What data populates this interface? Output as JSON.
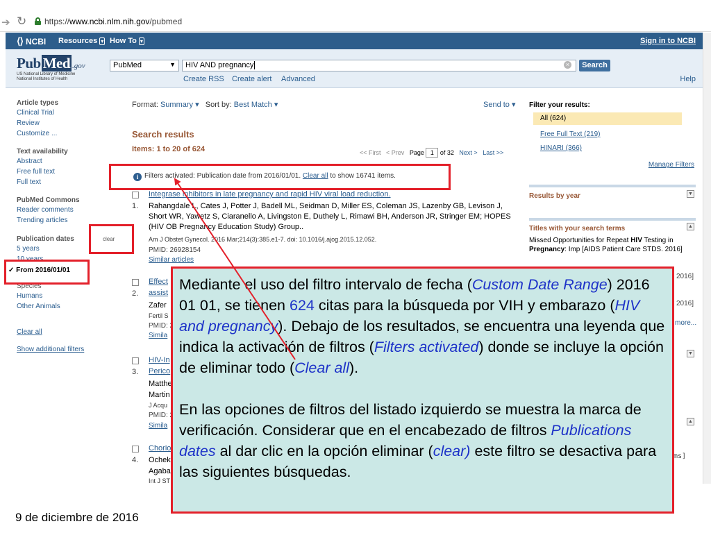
{
  "browser": {
    "url_scheme": "https://",
    "url_host": "www.ncbi.nlm.nih.gov",
    "url_path": "/pubmed"
  },
  "ncbi": {
    "logo": "NCBI",
    "menu": [
      "Resources",
      "How To"
    ],
    "sign_in": "Sign in to NCBI"
  },
  "pubmed": {
    "logo_word": "Pub",
    "logo_med": "Med",
    "logo_gov": ".gov",
    "subtitle_1": "US National Library of Medicine",
    "subtitle_2": "National Institutes of Health",
    "database": "PubMed",
    "query": "HIV AND pregnancy",
    "search_button": "Search",
    "links": [
      "Create RSS",
      "Create alert",
      "Advanced"
    ],
    "help": "Help"
  },
  "sidebar": {
    "article_types_head": "Article types",
    "article_types": [
      "Clinical Trial",
      "Review",
      "Customize ..."
    ],
    "text_avail_head": "Text availability",
    "text_avail": [
      "Abstract",
      "Free full text",
      "Full text"
    ],
    "commons_head": "PubMed Commons",
    "commons": [
      "Reader comments",
      "Trending articles"
    ],
    "pubdates_head": "Publication dates",
    "pubdates": [
      "5 years",
      "10 years"
    ],
    "clear": "clear",
    "from_filter": "✓ From 2016/01/01",
    "species": [
      "Species",
      "Humans",
      "Other Animals"
    ],
    "clear_all": "Clear all",
    "show_additional": "Show additional filters"
  },
  "results": {
    "format_label": "Format:",
    "format_value": "Summary",
    "sort_label": "Sort by:",
    "sort_value": "Best Match",
    "send_to": "Send to",
    "title": "Search results",
    "items": "Items: 1 to 20 of 624",
    "pager_first": "<< First",
    "pager_prev": "< Prev",
    "pager_page_label": "Page",
    "pager_page": "1",
    "pager_of": "of 32",
    "pager_next": "Next >",
    "pager_last": "Last >>",
    "filters_note": "Filters activated: Publication date from 2016/01/01.",
    "filters_clear_all": "Clear all",
    "filters_tail": "to show 16741 items.",
    "list": [
      {
        "num": "1.",
        "title": "Integrase inhibitors in late pregnancy and rapid HIV viral load reduction.",
        "authors": "Rahangdale L, Cates J, Potter J, Badell ML, Seidman D, Miller ES, Coleman JS, Lazenby GB, Levison J, Short WR, Yawetz S, Ciaranello A, Livingston E, Duthely L, Rimawi BH, Anderson JR, Stringer EM; HOPES (HIV OB Pregnancy Education Study) Group..",
        "journal": "Am J Obstet Gynecol. 2016 Mar;214(3):385.e1-7. doi: 10.1016/j.ajog.2015.12.052.",
        "pmid": "PMID: 26928154",
        "similar": "Similar articles"
      },
      {
        "num": "2.",
        "title": "Effect",
        "title2": "assist",
        "authors": "Zafer",
        "journal": "Fertil S",
        "pmid": "PMID: 2",
        "similar": "Simila"
      },
      {
        "num": "3.",
        "title": "HIV-In",
        "title2": "Perico",
        "authors": "Matthe",
        "authors2": "Martin",
        "journal": "J Acqu",
        "pmid": "PMID: 2",
        "similar": "Simila"
      },
      {
        "num": "4.",
        "title": "Chorio",
        "authors": "Ochek",
        "authors2": "Agaba",
        "journal": "Int J ST"
      }
    ]
  },
  "right": {
    "filter_head": "Filter your results:",
    "filter_all": "All (624)",
    "free_full_text": "Free Full Text (219)",
    "hinari": "HINARI (366)",
    "manage_filters": "Manage Filters",
    "results_by_year": "Results by year",
    "titles_head": "Titles with your search terms",
    "titles_text_1": "Missed Opportunities for Repeat ",
    "titles_hiv": "HIV",
    "titles_text_2": " Testing in ",
    "titles_pregnancy": "Pregnancy",
    "titles_text_3": ": Imp",
    "titles_cite": "[AIDS Patient Care STDS. 2016]",
    "frag_1": "2016]",
    "frag_2": "2016]",
    "frag_more": "more...",
    "frag_ms": "ms]"
  },
  "callout": {
    "p1_a": "Mediante el uso del filtro intervalo de fecha (",
    "p1_custom": "Custom Date Range",
    "p1_b": ") 2016 01 01, se tienen ",
    "p1_624": "624",
    "p1_c": " citas para la búsqueda por VIH y embarazo (",
    "p1_hiv": "HIV and pregnancy",
    "p1_d": "). Debajo de los resultados, se encuentra una leyenda que indica la activación de filtros (",
    "p1_filters": "Filters activated",
    "p1_e": ") donde se incluye la opción de eliminar todo (",
    "p1_clear": "Clear all",
    "p1_f": ").",
    "p2_a": "En las opciones de filtros del listado izquierdo se muestra la marca de verificación. Considerar que en el encabezado de filtros ",
    "p2_pub": "Publications dates",
    "p2_b": " al dar clic en la opción eliminar (",
    "p2_clear": "clear)",
    "p2_c": " este filtro se desactiva para las siguientes búsquedas."
  },
  "footer_date": "9 de diciembre de 2016",
  "colors": {
    "ncbi_bar": "#2d5d8b",
    "callout_bg": "#cbe8e6",
    "highlight_red": "#e3202a",
    "italic_blue": "#1d32c8",
    "results_brown": "#985735"
  }
}
